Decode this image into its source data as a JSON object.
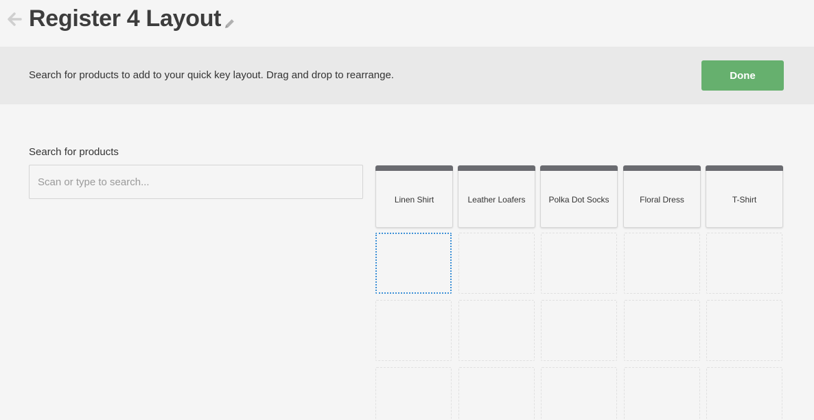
{
  "header": {
    "title": "Register 4 Layout",
    "back_icon": "arrow-left-icon",
    "edit_icon": "pencil-icon"
  },
  "banner": {
    "instruction": "Search for products to add to your quick key layout. Drag and drop to rearrange.",
    "done_label": "Done"
  },
  "search": {
    "label": "Search for products",
    "placeholder": "Scan or type to search...",
    "value": ""
  },
  "quick_keys": [
    {
      "label": "Linen Shirt"
    },
    {
      "label": "Leather Loafers"
    },
    {
      "label": "Polka Dot Socks"
    },
    {
      "label": "Floral Dress"
    },
    {
      "label": "T-Shirt"
    }
  ],
  "colors": {
    "done_button": "#66b06e",
    "key_bar": "#6a6b70",
    "active_slot_border": "#3a8fd6"
  }
}
